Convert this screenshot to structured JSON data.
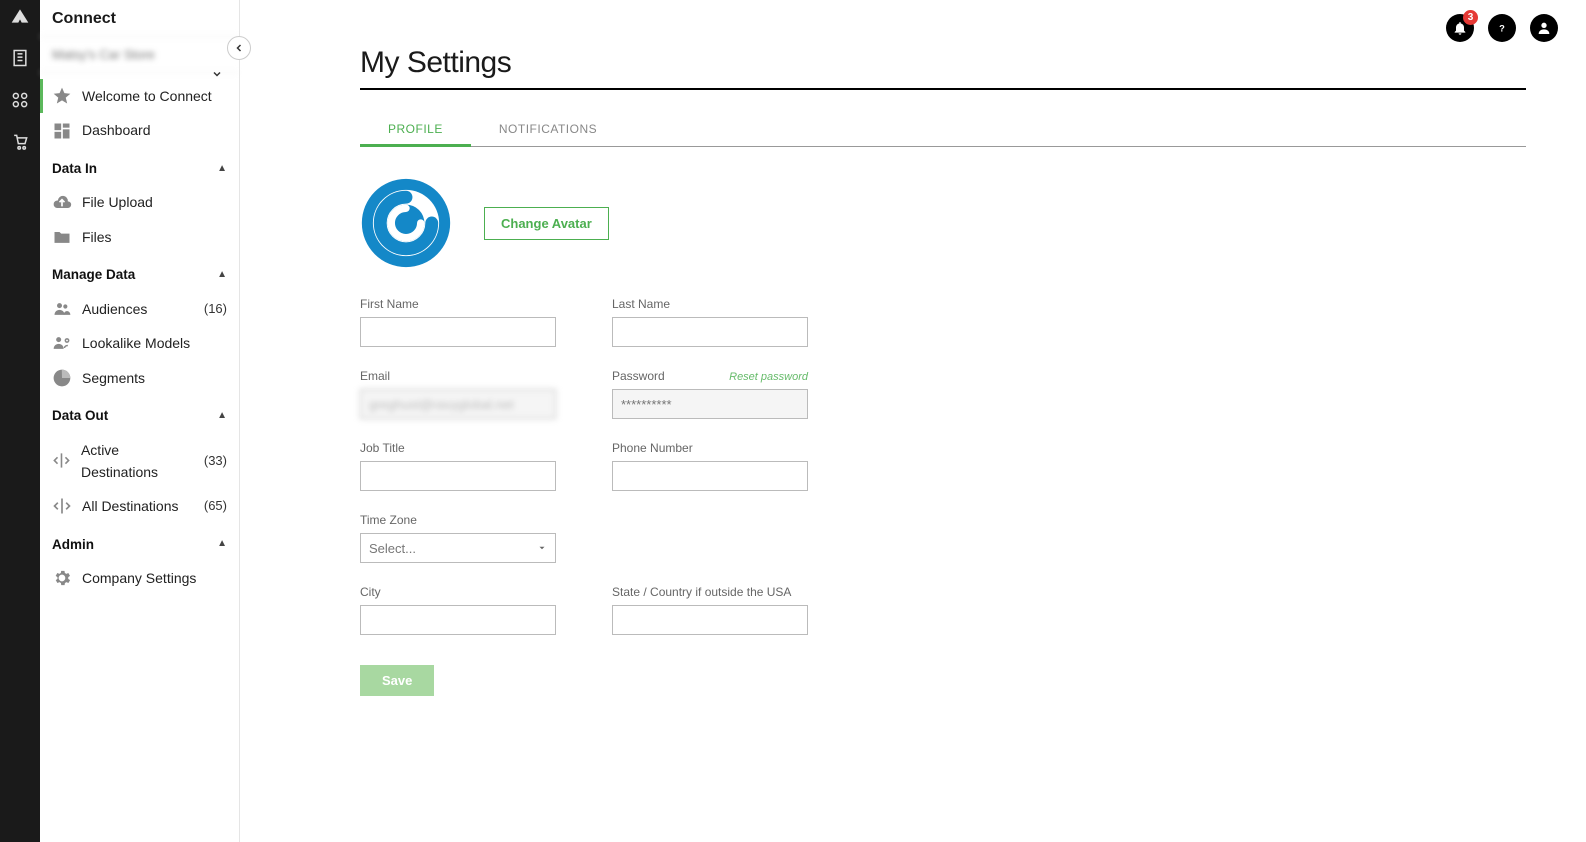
{
  "brand": "Connect",
  "org_name": "Matsy's Car Store",
  "sidebar": {
    "items": [
      {
        "label": "Welcome to Connect",
        "icon": "star-icon",
        "active": true
      },
      {
        "label": "Dashboard",
        "icon": "dashboard-icon"
      }
    ],
    "sections": [
      {
        "header": "Data In",
        "items": [
          {
            "label": "File Upload",
            "icon": "cloud-upload-icon"
          },
          {
            "label": "Files",
            "icon": "folder-icon"
          }
        ]
      },
      {
        "header": "Manage Data",
        "items": [
          {
            "label": "Audiences",
            "icon": "people-icon",
            "count": "(16)"
          },
          {
            "label": "Lookalike Models",
            "icon": "lookalike-icon"
          },
          {
            "label": "Segments",
            "icon": "pie-icon"
          }
        ]
      },
      {
        "header": "Data Out",
        "items": [
          {
            "label": "Active Destinations",
            "icon": "destinations-icon",
            "count": "(33)"
          },
          {
            "label": "All Destinations",
            "icon": "destinations-icon",
            "count": "(65)"
          }
        ]
      },
      {
        "header": "Admin",
        "items": [
          {
            "label": "Company Settings",
            "icon": "gear-icon"
          }
        ]
      }
    ]
  },
  "header": {
    "notif_count": "3"
  },
  "page": {
    "title": "My Settings",
    "tabs": [
      {
        "label": "PROFILE",
        "active": true
      },
      {
        "label": "NOTIFICATIONS"
      }
    ]
  },
  "form": {
    "change_avatar_label": "Change Avatar",
    "first_name_label": "First Name",
    "last_name_label": "Last Name",
    "email_label": "Email",
    "email_value": "greghust@ravyglobal.net",
    "password_label": "Password",
    "password_placeholder": "**********",
    "reset_password_label": "Reset password",
    "job_title_label": "Job Title",
    "phone_label": "Phone Number",
    "timezone_label": "Time Zone",
    "timezone_placeholder": "Select...",
    "city_label": "City",
    "state_label": "State / Country if outside the USA",
    "save_label": "Save"
  }
}
